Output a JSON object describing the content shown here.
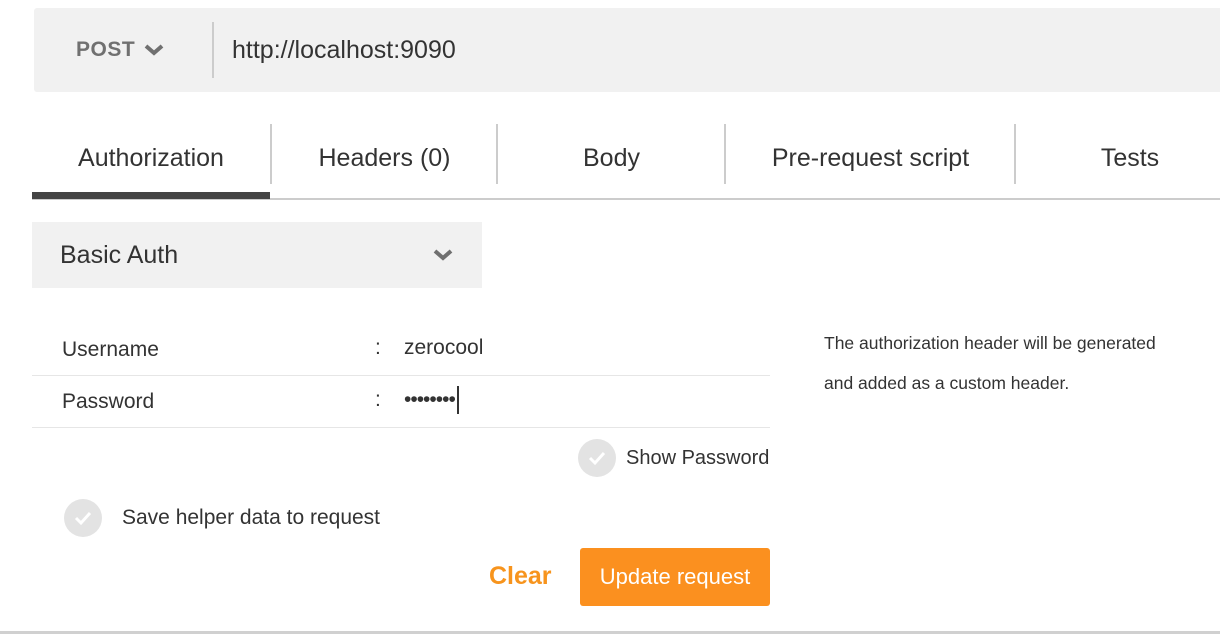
{
  "request": {
    "method": "POST",
    "url": "http://localhost:9090"
  },
  "tabs": [
    {
      "label": "Authorization",
      "active": true
    },
    {
      "label": "Headers (0)"
    },
    {
      "label": "Body"
    },
    {
      "label": "Pre-request script"
    },
    {
      "label": "Tests"
    }
  ],
  "auth": {
    "type": "Basic Auth",
    "username_label": "Username",
    "username_value": "zerocool",
    "password_label": "Password",
    "password_value": "••••••••",
    "separator": ":",
    "show_password_label": "Show Password",
    "show_password_checked": false,
    "save_helper_label": "Save helper data to request",
    "save_helper_checked": false,
    "help_line1": "The authorization header will be generated",
    "help_line2": "and added as a custom header.",
    "clear_label": "Clear",
    "update_label": "Update request"
  },
  "colors": {
    "accent": "#fb901f",
    "active_tab": "#444444"
  }
}
